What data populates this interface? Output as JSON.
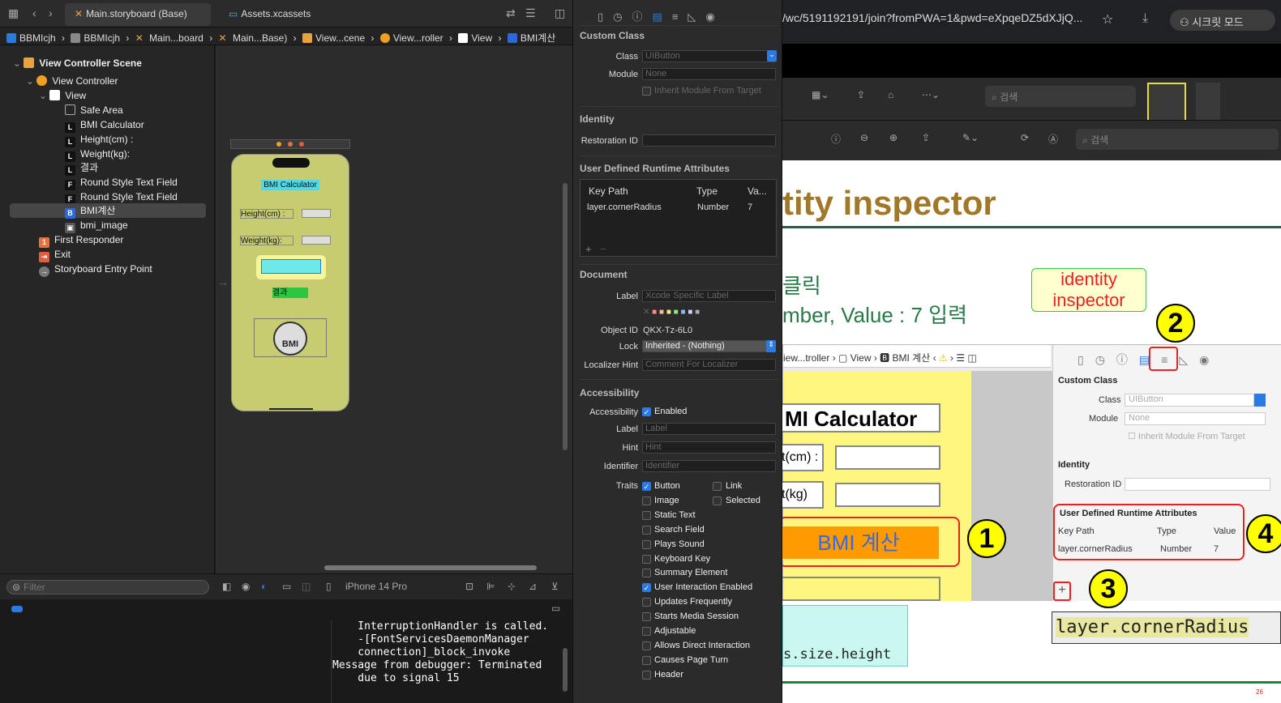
{
  "tabs": [
    {
      "label": "Main.storyboard (Base)"
    },
    {
      "label": "Assets.xcassets"
    }
  ],
  "breadcrumbs": [
    "BBMIcjh",
    "BBMIcjh",
    "Main...board",
    "Main...Base)",
    "View...cene",
    "View...roller",
    "View",
    "BMI계산"
  ],
  "navigator": {
    "items": [
      {
        "label": "View Controller Scene"
      },
      {
        "label": "View Controller"
      },
      {
        "label": "View"
      },
      {
        "label": "Safe Area"
      },
      {
        "label": "BMI Calculator"
      },
      {
        "label": "Height(cm) :"
      },
      {
        "label": "Weight(kg):"
      },
      {
        "label": "결과"
      },
      {
        "label": "Round Style Text Field"
      },
      {
        "label": "Round Style Text Field"
      },
      {
        "label": "BMI계산"
      },
      {
        "label": "bmi_image"
      },
      {
        "label": "First Responder"
      },
      {
        "label": "Exit"
      },
      {
        "label": "Storyboard Entry Point"
      }
    ],
    "filter_placeholder": "Filter"
  },
  "phone": {
    "title": "BMI Calculator",
    "height_label": "Height(cm) :",
    "weight_label": "Weight(kg):",
    "result": "결과",
    "gauge": "BMI"
  },
  "device": "iPhone 14 Pro",
  "console": "    InterruptionHandler is called.\n    -[FontServicesDaemonManager\n    connection]_block_invoke\nMessage from debugger: Terminated\n    due to signal 15",
  "inspector": {
    "custom_class": {
      "title": "Custom Class",
      "class_label": "Class",
      "class_value": "UIButton",
      "module_label": "Module",
      "module_value": "None",
      "inherit": "Inherit Module From Target"
    },
    "identity": {
      "title": "Identity",
      "restoration_label": "Restoration ID"
    },
    "udra": {
      "title": "User Defined Runtime Attributes",
      "col_key": "Key Path",
      "col_type": "Type",
      "col_value": "Va...",
      "key": "layer.cornerRadius",
      "type": "Number",
      "value": "7"
    },
    "document": {
      "title": "Document",
      "label_label": "Label",
      "label_placeholder": "Xcode Specific Label",
      "objid_label": "Object ID",
      "objid_value": "QKX-Tz-6L0",
      "lock_label": "Lock",
      "lock_value": "Inherited - (Nothing)",
      "loc_label": "Localizer Hint",
      "loc_placeholder": "Comment For Localizer"
    },
    "accessibility": {
      "title": "Accessibility",
      "acc_label": "Accessibility",
      "enabled": "Enabled",
      "label_label": "Label",
      "label_ph": "Label",
      "hint_label": "Hint",
      "hint_ph": "Hint",
      "id_label": "Identifier",
      "id_ph": "Identifier",
      "traits_label": "Traits"
    },
    "traits": [
      {
        "label": "Button",
        "on": true
      },
      {
        "label": "Image",
        "on": false
      },
      {
        "label": "Static Text",
        "on": false
      },
      {
        "label": "Search Field",
        "on": false
      },
      {
        "label": "Plays Sound",
        "on": false
      },
      {
        "label": "Keyboard Key",
        "on": false
      },
      {
        "label": "Summary Element",
        "on": false
      },
      {
        "label": "User Interaction Enabled",
        "on": true
      },
      {
        "label": "Updates Frequently",
        "on": false
      },
      {
        "label": "Starts Media Session",
        "on": false
      },
      {
        "label": "Adjustable",
        "on": false
      },
      {
        "label": "Allows Direct Interaction",
        "on": false
      },
      {
        "label": "Causes Page Turn",
        "on": false
      },
      {
        "label": "Header",
        "on": false
      }
    ],
    "traits_right": [
      {
        "label": "Link",
        "on": false
      },
      {
        "label": "Selected",
        "on": false
      }
    ]
  },
  "browser": {
    "url": "/wc/5191192191/join?fromPWA=1&pwd=eXpqeDZ5dXJjQ...",
    "incognito": "시크릿 모드",
    "view": "보기",
    "search1": "검색",
    "search2": "검색",
    "slide_title": "tity inspector",
    "line1": "클릭",
    "line2": "mber, Value : 7 입력",
    "callout": "identity\ninspector",
    "nums": [
      "2",
      "1",
      "3",
      "4"
    ],
    "shot": {
      "crumb1": "iew...troller",
      "crumb2": "View",
      "crumb3": "BMI 계산",
      "bmi_calc": "MI Calculator",
      "cm": "t(cm) :",
      "kg": "t(kg)",
      "button": "BMI 계산",
      "custom_class": "Custom Class",
      "class": "Class",
      "class_val": "UIButton",
      "module": "Module",
      "module_val": "None",
      "inherit": "Inherit Module From Target",
      "identity": "Identity",
      "restoration": "Restoration ID",
      "udra": "User Defined Runtime Attributes",
      "keypath": "Key Path",
      "type": "Type",
      "value": "Value",
      "row_key": "layer.cornerRadius",
      "row_type": "Number",
      "row_val": "7"
    },
    "code1": "layer.cornerRadius",
    "code2": "s.size.height",
    "page_num": "26"
  }
}
